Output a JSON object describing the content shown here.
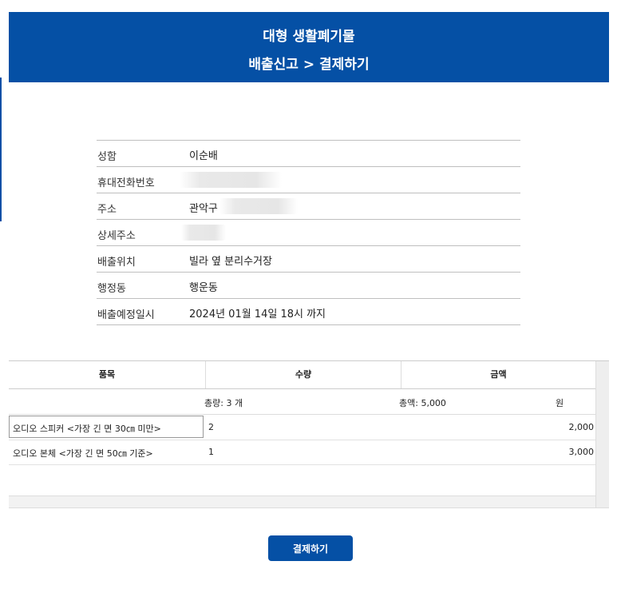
{
  "header": {
    "title": "대형 생활폐기물",
    "subtitle": "배출신고 > 결제하기"
  },
  "applicant": {
    "rows": [
      {
        "label": "성함",
        "value": "이순배"
      },
      {
        "label": "휴대전화번호",
        "value": ""
      },
      {
        "label": "주소",
        "value": "관악구"
      },
      {
        "label": "상세주소",
        "value": ""
      },
      {
        "label": "배출위치",
        "value": "빌라 옆 분리수거장"
      },
      {
        "label": "행정동",
        "value": "행운동"
      },
      {
        "label": "배출예정일시",
        "value": "2024년 01월 14일 18시 까지"
      }
    ]
  },
  "items_table": {
    "headers": [
      "품목",
      "수량",
      "금액"
    ],
    "summary": {
      "total_qty": "총량: 3 개",
      "total_amount": "총액: 5,000",
      "currency": "원"
    },
    "rows": [
      {
        "name": "오디오 스피커 <가장 긴 면 30㎝ 미만>",
        "qty": "2",
        "price": "2,000"
      },
      {
        "name": "오디오 본체 <가장 긴 면 50㎝ 기준>",
        "qty": "1",
        "price": "3,000"
      }
    ]
  },
  "actions": {
    "pay_label": "결제하기"
  },
  "colors": {
    "brand_blue": "#0550a5"
  }
}
